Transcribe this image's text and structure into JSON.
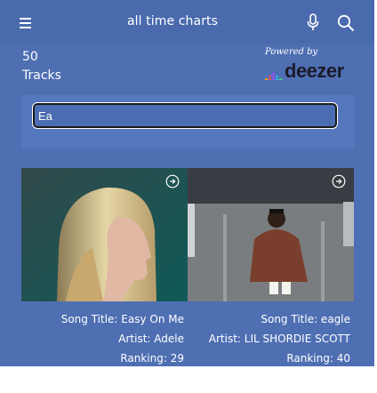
{
  "header": {
    "title": "all time charts",
    "menu_icon": "menu-icon",
    "mic_icon": "mic-icon",
    "search_icon": "search-icon"
  },
  "stats": {
    "count": "50",
    "label": "Tracks"
  },
  "branding": {
    "powered_by": "Powered by",
    "logo_text": "deezer"
  },
  "search": {
    "value": "Ea",
    "placeholder": ""
  },
  "tracks": [
    {
      "title": "Song Title: Easy On Me",
      "artist": "Artist: Adele",
      "ranking": "Ranking: 29",
      "play_icon": "play-circle-icon"
    },
    {
      "title": "Song Title: eagle",
      "artist": "Artist: LIL SHORDIE SCOTT",
      "ranking": "Ranking: 40",
      "play_icon": "play-circle-icon"
    }
  ],
  "colors": {
    "background": "#4f6fb3",
    "header": "#4a6aae",
    "panel": "#5577bd",
    "logo_dark": "#1b1b2a"
  }
}
